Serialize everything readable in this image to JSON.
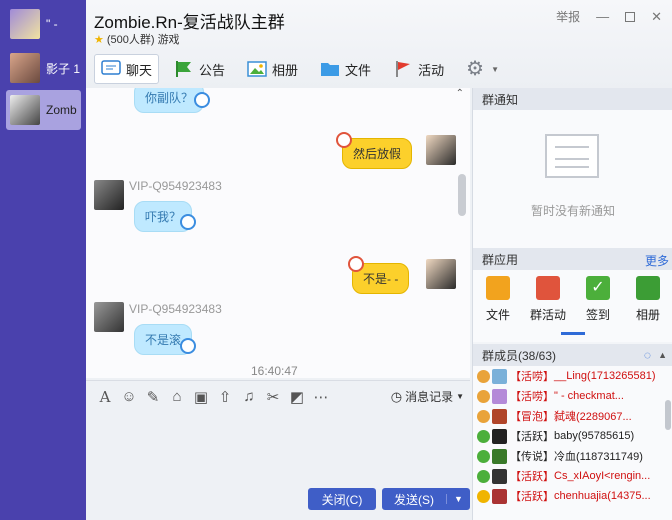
{
  "sidebar": {
    "items": [
      {
        "name": "\" -"
      },
      {
        "name": "影子 1"
      },
      {
        "name": "Zomb"
      }
    ]
  },
  "header": {
    "title": "Zombie.Rn-复活战队主群",
    "member_count": "(500人群)",
    "category": "游戏",
    "report": "举报"
  },
  "tabs": [
    {
      "label": "聊天"
    },
    {
      "label": "公告"
    },
    {
      "label": "相册"
    },
    {
      "label": "文件"
    },
    {
      "label": "活动"
    }
  ],
  "chat": {
    "messages": [
      {
        "text": "你副队？"
      },
      {
        "text": "然后放假"
      },
      {
        "sender": "VIP-Q954923483",
        "text": "吓我？"
      },
      {
        "text": "不是- -"
      },
      {
        "sender": "VIP-Q954923483",
        "text": "不是滚"
      }
    ],
    "timestamp": "16:40:47"
  },
  "toolbar": {
    "history": "消息记录"
  },
  "buttons": {
    "close": "关闭(C)",
    "send": "发送(S)"
  },
  "right": {
    "notice_title": "群通知",
    "notice_empty": "暂时没有新通知",
    "apps_title": "群应用",
    "more": "更多",
    "apps": [
      {
        "label": "文件",
        "color": "#f2a31e"
      },
      {
        "label": "群活动",
        "color": "#e0543c"
      },
      {
        "label": "签到",
        "color": "#4caf3b"
      },
      {
        "label": "相册",
        "color": "#3c9d35"
      }
    ],
    "members_title": "群成员(38/63)",
    "members": [
      {
        "tag": "【活唠】",
        "name": "__Ling(1713265581)",
        "red": true
      },
      {
        "tag": "【活唠】",
        "name": "\" -      checkmat...",
        "red": true
      },
      {
        "tag": "【冒泡】",
        "name": "弑魂(2289067...",
        "red": true
      },
      {
        "tag": "【活跃】",
        "name": "baby(95785615)",
        "red": false
      },
      {
        "tag": "【传说】",
        "name": "冷血(1187311749)",
        "red": false
      },
      {
        "tag": "【活跃】",
        "name": "Cs_xIAoyI<rengin...",
        "red": true
      },
      {
        "tag": "【活跃】",
        "name": "chenhuajia(14375...",
        "red": true
      }
    ]
  },
  "colors": {
    "sidebar": "#4a41ad",
    "accent_button": "#3f5ec7",
    "bubble_blue": "#bfe9ff",
    "bubble_yellow": "#fcd02b"
  }
}
